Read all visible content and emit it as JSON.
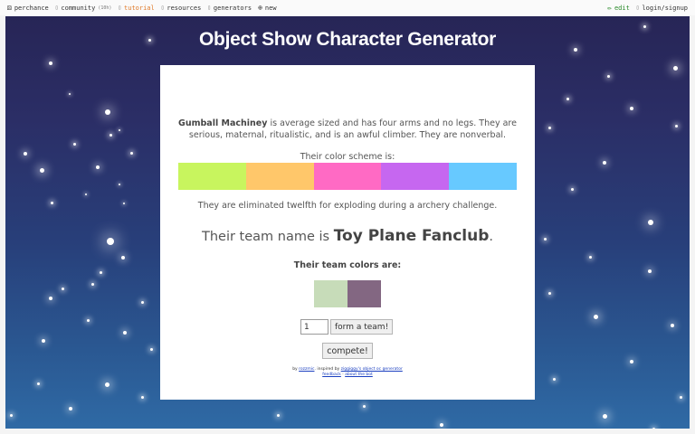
{
  "nav": {
    "left": [
      {
        "icon": "⚄",
        "label": "perchance"
      },
      {
        "icon": "▯",
        "label": "community",
        "count": "(10h)"
      },
      {
        "icon": "▯",
        "label": "tutorial"
      },
      {
        "icon": "▯",
        "label": "resources"
      },
      {
        "icon": "▯",
        "label": "generators"
      },
      {
        "icon": "⊕",
        "label": "new"
      }
    ],
    "right": [
      {
        "icon": "✏",
        "label": "edit"
      },
      {
        "icon": "▯",
        "label": "login/signup"
      }
    ]
  },
  "page": {
    "title": "Object Show Character Generator"
  },
  "character": {
    "name": "Gumball Machiney",
    "description": " is average sized and has four arms and no legs. They are serious, maternal, ritualistic, and is an awful climber. They are nonverbal.",
    "scheme_label": "Their color scheme is:",
    "scheme_colors": [
      "#c8f55e",
      "#ffc76a",
      "#ff6ac4",
      "#c667f0",
      "#67c9ff"
    ],
    "elimination": "They are eliminated twelfth for exploding during a archery challenge."
  },
  "team": {
    "prefix": "Their team name is ",
    "name": "Toy Plane Fanclub",
    "suffix": ".",
    "colors_label": "Their team colors are:",
    "colors": [
      "#c7dcb9",
      "#836782"
    ]
  },
  "form": {
    "quantity_value": "1",
    "form_team_label": "form a team!",
    "compete_label": "compete!"
  },
  "credits": {
    "by": "by ",
    "author": "rozzmic",
    "inspired": ". inspired by ",
    "inspiration": "ziggiggy's object oc generator",
    "feedback": "feedback",
    "separator": " · ",
    "about": "about the bot"
  },
  "colors": {
    "sky_top": "#272556",
    "sky_bottom": "#2f6aa5",
    "active_nav": "#e07a2a",
    "edit_nav": "#2a8a2a"
  }
}
